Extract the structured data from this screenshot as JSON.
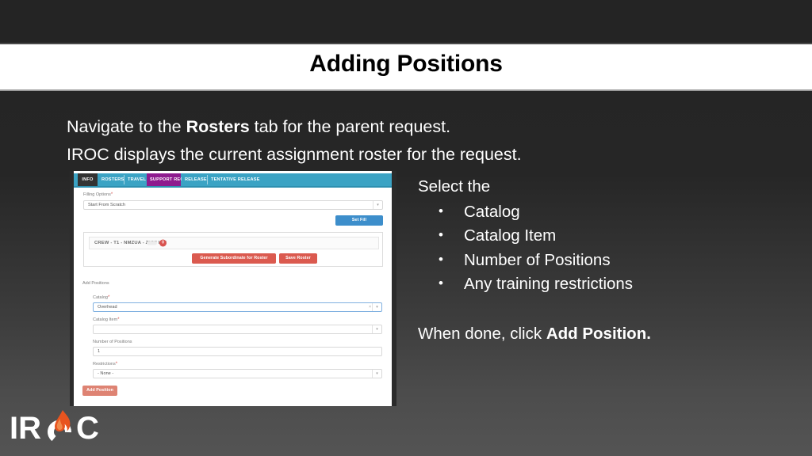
{
  "slide": {
    "title": "Adding Positions",
    "lead_line1_pre": "Navigate to the ",
    "lead_line1_bold": "Rosters",
    "lead_line1_post": " tab for the parent request.",
    "lead_line2": "IROC displays the current assignment roster for the request."
  },
  "right_column": {
    "intro": "Select the",
    "bullets": [
      "Catalog",
      "Catalog Item",
      "Number of Positions",
      "Any training restrictions"
    ],
    "closing_pre": "When done, click ",
    "closing_bold": "Add Position."
  },
  "app_screenshot": {
    "tabs": [
      {
        "label": "INFO",
        "state": "active-dark"
      },
      {
        "label": "ROSTERS",
        "state": "teal"
      },
      {
        "label": "TRAVEL",
        "state": "teal"
      },
      {
        "label": "SUPPORT REQ",
        "state": "purple"
      },
      {
        "label": "RELEASE",
        "state": "teal"
      },
      {
        "label": "TENTATIVE RELEASE",
        "state": "teal"
      }
    ],
    "filling_options": {
      "label": "Filling Options",
      "required_marker": "*",
      "value": "Start From Scratch",
      "caret": "▾"
    },
    "set_fill_button": "Set Fill",
    "roster": {
      "name": "CREW - T1 - NMZUA - ZUNI IHC",
      "badge_count": "0",
      "generate_button": "Generate Subordinate for Roster",
      "save_button": "Save Roster"
    },
    "add_positions_heading": "Add Positions",
    "fields": {
      "catalog": {
        "label": "Catalog",
        "required_marker": "*",
        "value": "Overhead",
        "clear": "×",
        "caret": "▾"
      },
      "catalog_item": {
        "label": "Catalog Item",
        "required_marker": "*",
        "value": "",
        "caret": "▾"
      },
      "number_of_positions": {
        "label": "Number of Positions",
        "required_marker": "",
        "value": "1"
      },
      "restrictions": {
        "label": "Restrictions",
        "required_marker": "*",
        "value": "- None -",
        "caret": "▾"
      }
    },
    "add_position_button": "Add Position"
  },
  "logo": {
    "text": "IROC",
    "flame_color": "#e8541f",
    "text_color": "#ffffff"
  },
  "colors": {
    "tab_teal": "#3ba3c4",
    "tab_purple": "#8e1b8e",
    "tab_dark": "#333333",
    "button_blue": "#3d8ecb",
    "button_red": "#db5a4f",
    "button_salmon": "#de8373",
    "required_red": "#d9534f",
    "slide_bg_top": "#242424",
    "slide_bg_bottom": "#545454"
  }
}
